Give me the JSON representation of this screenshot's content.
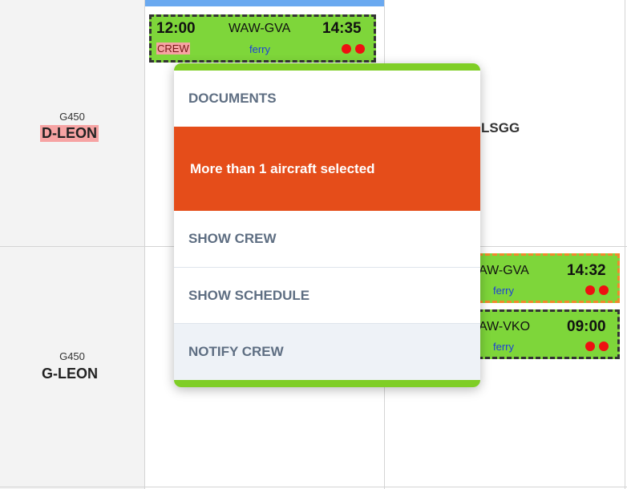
{
  "aircraft": [
    {
      "type": "G450",
      "registration": "D-LEON"
    },
    {
      "type": "G450",
      "registration": "G-LEON"
    }
  ],
  "airport_label": "LSGG",
  "flights": [
    {
      "dep_time": "12:00",
      "route": "WAW-GVA",
      "arr_time": "14:35",
      "crew_tag": "CREW",
      "sub": "ferry"
    },
    {
      "route_partial": "AW-GVA",
      "arr_time": "14:32",
      "sub": "ferry"
    },
    {
      "route_partial": "AW-VKO",
      "arr_time": "09:00",
      "sub": "ferry"
    }
  ],
  "context_menu": {
    "documents": "DOCUMENTS",
    "warning": "More than 1 aircraft selected",
    "show_crew": "SHOW CREW",
    "show_schedule": "SHOW SCHEDULE",
    "notify_crew": "NOTIFY CREW"
  },
  "colors": {
    "flight_bg": "#7ed63a",
    "menu_accent": "#7fce26",
    "warning_bg": "#e54d1a",
    "selection_bar": "#6aa9f0",
    "status_dot": "#ee1111"
  }
}
